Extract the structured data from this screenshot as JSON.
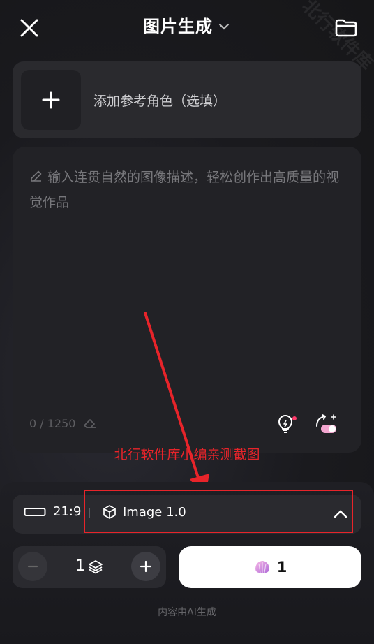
{
  "header": {
    "title": "图片生成"
  },
  "reference": {
    "label": "添加参考角色（选填）"
  },
  "prompt": {
    "placeholder": "输入连贯自然的图像描述，轻松创作出高质量的视觉作品",
    "counter": "0 / 1250"
  },
  "annotation": {
    "text": "北行软件库小编亲测截图"
  },
  "settings": {
    "ratio": "21:9",
    "model": "Image 1.0"
  },
  "quantity": {
    "value": "1"
  },
  "generate": {
    "cost": "1"
  },
  "footer": {
    "note": "内容由AI生成"
  },
  "watermark": {
    "text": "北行软件库"
  },
  "colors": {
    "annotation_red": "#e8242a",
    "accent_pink": "#ff3b6b"
  }
}
